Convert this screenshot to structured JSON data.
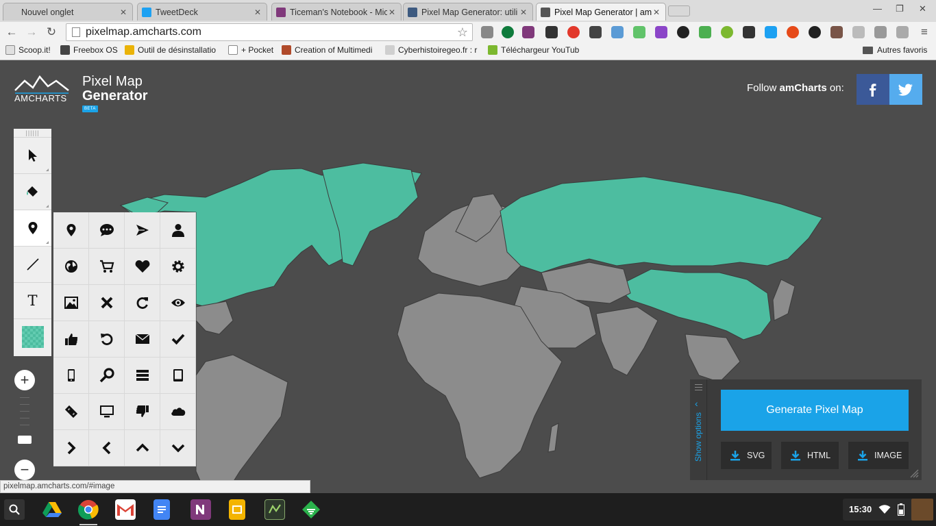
{
  "browser": {
    "tabs": [
      {
        "title": "Nouvel onglet",
        "favicon_color": "#d0d0d0",
        "active": false
      },
      {
        "title": "TweetDeck",
        "favicon_color": "#1da1f2",
        "active": false
      },
      {
        "title": "Ticeman's Notebook - Mic",
        "favicon_color": "#80397b",
        "active": false
      },
      {
        "title": "Pixel Map Generator: utili",
        "favicon_color": "#3d5a80",
        "active": false
      },
      {
        "title": "Pixel Map Generator | am",
        "favicon_color": "#555555",
        "active": true
      }
    ],
    "url": "pixelmap.amcharts.com",
    "bookmarks": [
      {
        "label": "Scoop.it!"
      },
      {
        "label": "Freebox OS"
      },
      {
        "label": "Outil de désinstallatio"
      },
      {
        "label": "+ Pocket"
      },
      {
        "label": "Creation of Multimedi"
      },
      {
        "label": "Cyberhistoiregeo.fr : r"
      },
      {
        "label": "Téléchargeur YouTub"
      },
      {
        "label": "Autres favoris"
      }
    ]
  },
  "page": {
    "logo_text": "AMCHARTS",
    "brand_line1": "Pixel Map",
    "brand_line2": "Generator",
    "beta": "BETA",
    "follow_prefix": "Follow ",
    "follow_brand": "amCharts",
    "follow_suffix": " on:",
    "colors": {
      "accent": "#1aa3e8",
      "highlight_country": "#4dbda0",
      "land": "#8c8c8c",
      "ocean": "#4c4c4c",
      "facebook": "#3b5998",
      "twitter": "#55acee"
    },
    "tools": [
      "pointer-icon",
      "fill-bucket-icon",
      "map-marker-icon",
      "line-icon",
      "text-icon",
      "color-swatch-icon"
    ],
    "tool_text_glyph": "T",
    "icon_grid": [
      "map-marker-icon",
      "chat-bubble-icon",
      "paper-plane-icon",
      "user-icon",
      "globe-icon",
      "cart-icon",
      "heart-icon",
      "gear-icon",
      "picture-icon",
      "close-icon",
      "refresh-icon",
      "eye-icon",
      "thumbs-up-icon",
      "undo-icon",
      "envelope-icon",
      "checkmark-icon",
      "phone-icon",
      "magnifier-icon",
      "list-icon",
      "tablet-icon",
      "link-icon",
      "monitor-icon",
      "thumbs-down-icon",
      "cloud-icon",
      "chevron-right-icon",
      "chevron-left-icon",
      "chevron-up-icon",
      "chevron-down-icon"
    ],
    "options": {
      "show_options": "Show options",
      "generate": "Generate Pixel Map",
      "downloads": [
        "SVG",
        "HTML",
        "IMAGE"
      ]
    },
    "status_url": "pixelmap.amcharts.com/#image"
  },
  "taskbar": {
    "apps": [
      "Google Drive",
      "Chrome",
      "Gmail",
      "Docs",
      "OneNote",
      "Slides",
      "Tool",
      "Feedly"
    ],
    "clock": "15:30"
  }
}
